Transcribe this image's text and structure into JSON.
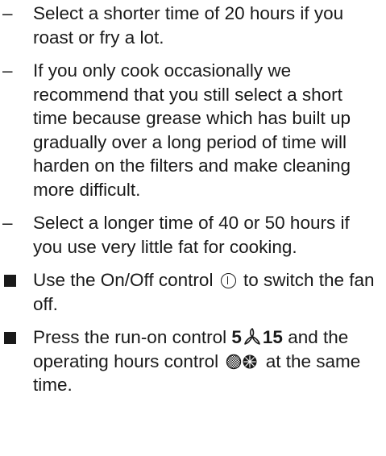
{
  "items": [
    {
      "marker": "–",
      "text": "Select a shorter time of 20 hours if you roast or fry a lot."
    },
    {
      "marker": "–",
      "text": "If you only cook occasionally we recommend that you still select a short time because grease which has built up gradually over a long period of time will harden on the filters and make cleaning more difficult."
    },
    {
      "marker": "–",
      "text": "Select a longer time of 40 or 50 hours if you use very little fat for cooking."
    }
  ],
  "steps": [
    {
      "before": "Use the On/Off control",
      "icon": "power-icon",
      "after": "to switch the fan off."
    },
    {
      "before": "Press the run-on control",
      "bold_start": "5",
      "icon_mid": "fan-icon",
      "bold_end": "15",
      "middle": "and the operating hours control",
      "icon2": "filter-hours-icon",
      "after": "at the same time."
    }
  ]
}
